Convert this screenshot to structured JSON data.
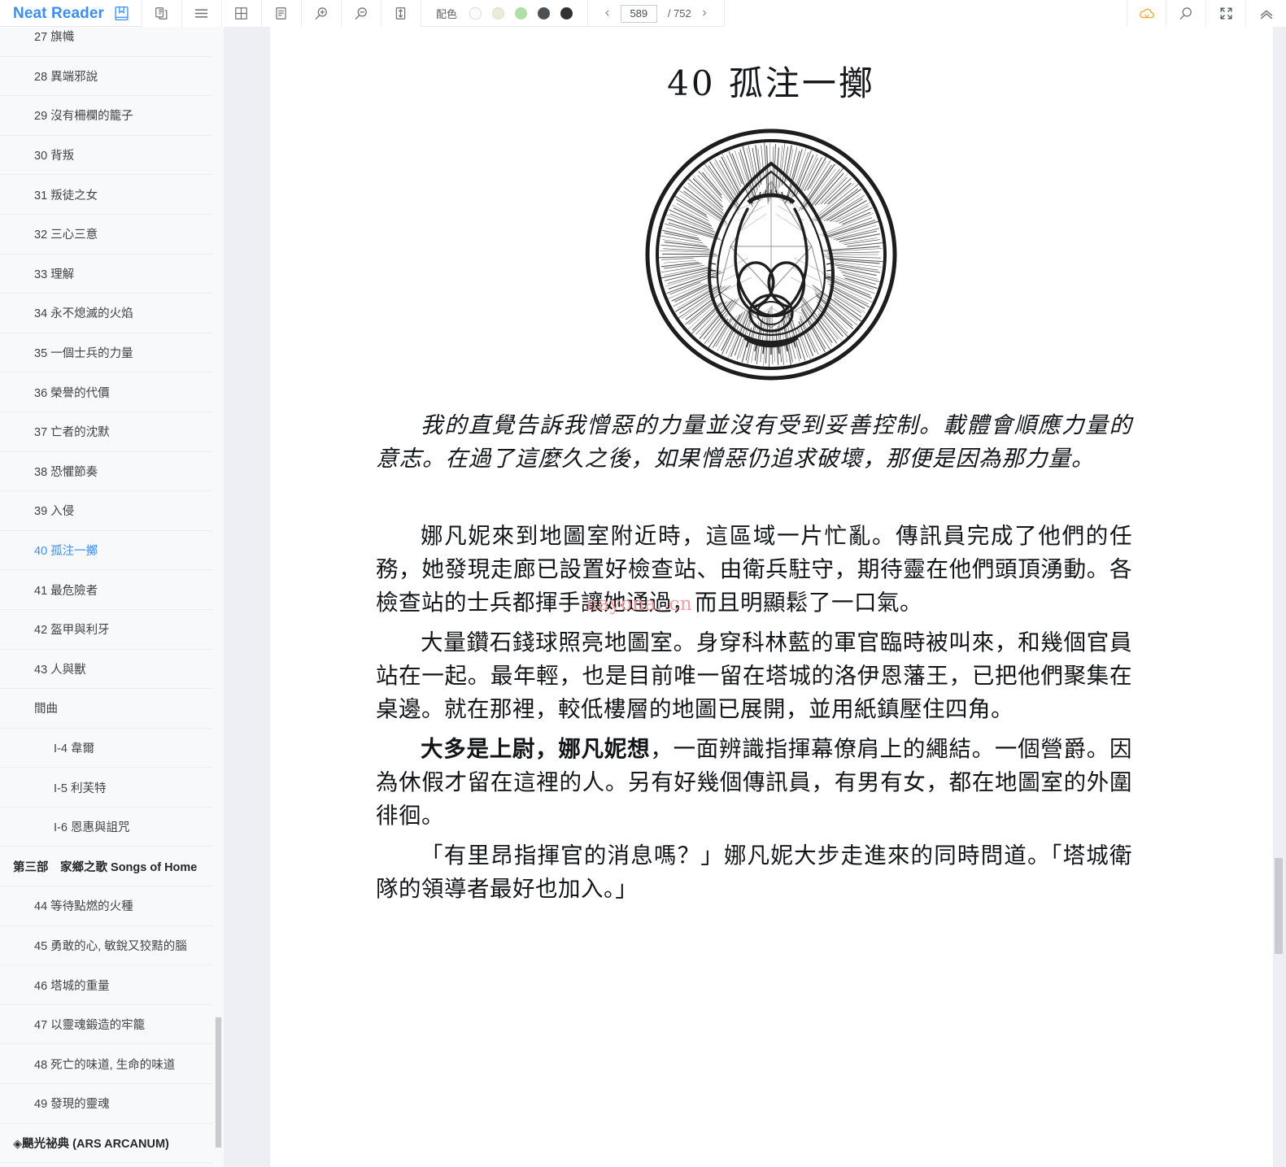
{
  "app": {
    "brand": "Neat Reader",
    "brand_color": "#3c8ef0"
  },
  "toolbar": {
    "icons": [
      {
        "name": "bookshelf-icon",
        "title": "書架"
      },
      {
        "name": "copy-notes-icon",
        "title": "筆記"
      },
      {
        "name": "hamburger-menu-icon",
        "title": "目錄"
      },
      {
        "name": "grid-layout-icon",
        "title": "版面"
      },
      {
        "name": "page-layout-icon",
        "title": "排版"
      },
      {
        "name": "zoom-in-icon",
        "title": "放大"
      },
      {
        "name": "zoom-out-icon",
        "title": "縮小"
      },
      {
        "name": "line-height-icon",
        "title": "行距"
      }
    ],
    "color_scheme": {
      "label": "配色",
      "swatches": [
        {
          "name": "swatch-white",
          "color": "#ffffff",
          "border": "#d8d9dd",
          "selected": false
        },
        {
          "name": "swatch-sepia",
          "color": "#ecead9",
          "border": "#dedcc9",
          "selected": false
        },
        {
          "name": "swatch-green",
          "color": "#aedfa5",
          "border": "#aedfa5",
          "selected": false
        },
        {
          "name": "swatch-dark-gray",
          "color": "#4d5154",
          "border": "#4d5154",
          "selected": false
        },
        {
          "name": "swatch-black",
          "color": "#2f3133",
          "border": "#2f3133",
          "selected": false
        }
      ]
    },
    "pager": {
      "prev": "‹",
      "next": "›",
      "current_page": "589",
      "page_placeholder": "589",
      "total": "/ 752"
    },
    "right_icons": [
      {
        "name": "cloud-sync-icon",
        "color": "#f2a93b"
      },
      {
        "name": "search-icon",
        "color": "#6e7176"
      },
      {
        "name": "fullscreen-icon",
        "color": "#4a4d52"
      },
      {
        "name": "collapse-toolbar-icon",
        "color": "#6e7176"
      }
    ]
  },
  "sidebar": {
    "items": [
      {
        "label": "27 旗幟",
        "level": 1,
        "active": false,
        "type": "chapter"
      },
      {
        "label": "28 異端邪說",
        "level": 1,
        "active": false,
        "type": "chapter"
      },
      {
        "label": "29 沒有柵欄的籠子",
        "level": 1,
        "active": false,
        "type": "chapter"
      },
      {
        "label": "30 背叛",
        "level": 1,
        "active": false,
        "type": "chapter"
      },
      {
        "label": "31 叛徒之女",
        "level": 1,
        "active": false,
        "type": "chapter"
      },
      {
        "label": "32 三心三意",
        "level": 1,
        "active": false,
        "type": "chapter"
      },
      {
        "label": "33 理解",
        "level": 1,
        "active": false,
        "type": "chapter"
      },
      {
        "label": "34 永不熄滅的火焰",
        "level": 1,
        "active": false,
        "type": "chapter"
      },
      {
        "label": "35 一個士兵的力量",
        "level": 1,
        "active": false,
        "type": "chapter"
      },
      {
        "label": "36 榮譽的代價",
        "level": 1,
        "active": false,
        "type": "chapter"
      },
      {
        "label": "37 亡者的沈默",
        "level": 1,
        "active": false,
        "type": "chapter"
      },
      {
        "label": "38 恐懼節奏",
        "level": 1,
        "active": false,
        "type": "chapter"
      },
      {
        "label": "39 入侵",
        "level": 1,
        "active": false,
        "type": "chapter"
      },
      {
        "label": "40 孤注一擲",
        "level": 1,
        "active": true,
        "type": "chapter"
      },
      {
        "label": "41 最危險者",
        "level": 1,
        "active": false,
        "type": "chapter"
      },
      {
        "label": "42 盔甲與利牙",
        "level": 1,
        "active": false,
        "type": "chapter"
      },
      {
        "label": "43 人與獸",
        "level": 1,
        "active": false,
        "type": "chapter"
      },
      {
        "label": "間曲",
        "level": 1,
        "active": false,
        "type": "chapter"
      },
      {
        "label": "I-4 韋爾",
        "level": 2,
        "active": false,
        "type": "chapter"
      },
      {
        "label": "I-5 利芙特",
        "level": 2,
        "active": false,
        "type": "chapter"
      },
      {
        "label": "I-6 恩惠與詛咒",
        "level": 2,
        "active": false,
        "type": "chapter"
      },
      {
        "label": "第三部　家鄉之歌 Songs of Home",
        "level": 0,
        "active": false,
        "type": "part"
      },
      {
        "label": "44 等待點燃的火種",
        "level": 1,
        "active": false,
        "type": "chapter"
      },
      {
        "label": "45 勇敢的心, 敏銳又狡黠的腦",
        "level": 1,
        "active": false,
        "type": "chapter"
      },
      {
        "label": "46 塔城的重量",
        "level": 1,
        "active": false,
        "type": "chapter"
      },
      {
        "label": "47 以靈魂鍛造的牢籠",
        "level": 1,
        "active": false,
        "type": "chapter"
      },
      {
        "label": "48 死亡的味道, 生命的味道",
        "level": 1,
        "active": false,
        "type": "chapter"
      },
      {
        "label": "49 發現的靈魂",
        "level": 1,
        "active": false,
        "type": "chapter"
      },
      {
        "label": "◈颶光祕典 (ARS ARCANUM)",
        "level": 0,
        "active": false,
        "type": "part"
      }
    ]
  },
  "page": {
    "chapter_title": "40 孤注一擲",
    "illustration": "chapter-head-gemstone-emblem",
    "watermark": "nayona. cn",
    "paragraphs": [
      {
        "style": "epigraph",
        "text": "我的直覺告訴我憎惡的力量並沒有受到妥善控制。載體會順應力量的意志。在過了這麼久之後，如果憎惡仍追求破壞，那便是因為那力量。"
      },
      {
        "style": "body",
        "lead": "",
        "text": "娜凡妮來到地圖室附近時，這區域一片忙亂。傳訊員完成了他們的任務，她發現走廊已設置好檢查站、由衛兵駐守，期待靈在他們頭頂湧動。各檢查站的士兵都揮手讓她通過，而且明顯鬆了一口氣。"
      },
      {
        "style": "body",
        "lead": "",
        "text": "大量鑽石錢球照亮地圖室。身穿科林藍的軍官臨時被叫來，和幾個官員站在一起。最年輕，也是目前唯一留在塔城的洛伊恩藩王，已把他們聚集在桌邊。就在那裡，較低樓層的地圖已展開，並用紙鎮壓住四角。"
      },
      {
        "style": "body",
        "lead": "大多是上尉，娜凡妮想",
        "text": "，一面辨識指揮幕僚肩上的繩結。一個營爵。因為休假才留在這裡的人。另有好幾個傳訊員，有男有女，都在地圖室的外圍徘徊。"
      },
      {
        "style": "body",
        "lead": "",
        "text": "「有里昂指揮官的消息嗎？」娜凡妮大步走進來的同時問道。「塔城衛隊的領導者最好也加入。」"
      }
    ]
  }
}
